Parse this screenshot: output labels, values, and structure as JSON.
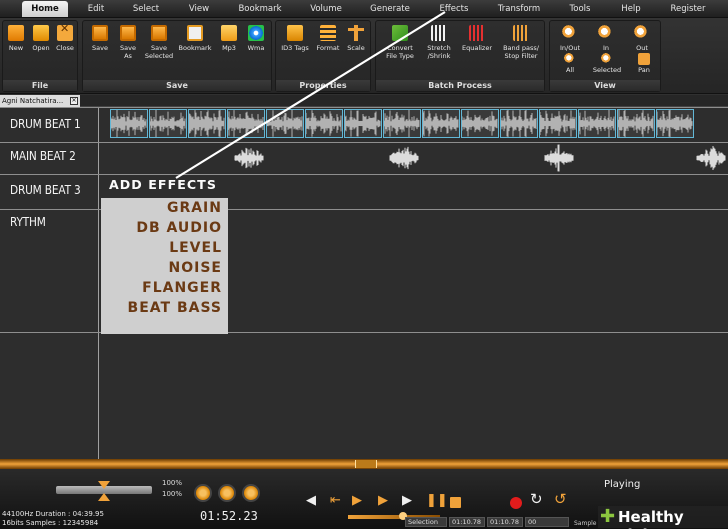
{
  "menu": {
    "items": [
      "Home",
      "Edit",
      "Select",
      "View",
      "Bookmark",
      "Volume",
      "Generate",
      "Effects",
      "Transform",
      "Tools",
      "Help",
      "Register"
    ],
    "active": "Home"
  },
  "ribbon": {
    "file": {
      "label": "File",
      "tools": [
        "New",
        "Open",
        "Close"
      ]
    },
    "save": {
      "label": "Save",
      "tools": [
        "Save",
        "Save\nAs",
        "Save\nSelected",
        "Bookmark",
        "Mp3",
        "Wma"
      ]
    },
    "properties": {
      "label": "Properties",
      "tools": [
        "ID3 Tags",
        "Format",
        "Scale"
      ]
    },
    "batch": {
      "label": "Batch Process",
      "tools": [
        "Convert\nFile Type",
        "Stretch\n/Shrink",
        "Equalizer",
        "Band pass/\nStop Filter"
      ]
    },
    "view": {
      "label": "View",
      "tools": [
        "In/Out",
        "In",
        "Out",
        "All",
        "Selected",
        "Pan"
      ]
    }
  },
  "document_tab": {
    "label": "Agni Natchatira..."
  },
  "tracks": {
    "labels": [
      "DRUM BEAT 1",
      "MAIN BEAT 2",
      "DRUM BEAT 3",
      "RYTHM"
    ]
  },
  "annotation": {
    "title": "ADD EFFECTS"
  },
  "effects_list": [
    "GRAIN",
    "DB AUDIO",
    "LEVEL",
    "NOISE",
    "FLANGER",
    "BEAT BASS"
  ],
  "transport": {
    "pitch_top": "100%",
    "pitch_bottom": "100%",
    "time": "01:52.23",
    "format_line1": "44100Hz  Duration : 04:39.95",
    "format_line2": "16bits  Samples : 12345984",
    "selection_label": "Selection",
    "sel_start": "01:10.78",
    "sel_end": "01:10.78",
    "sel_len": "00",
    "samples_label": "Sample",
    "status": "Playing",
    "volume_level": 0.6
  },
  "watermark": {
    "text": "Healthy Living"
  },
  "colors": {
    "accent": "#f0a23a",
    "clip_border": "#62b7d6",
    "effect_text": "#6b3a14",
    "effects_panel_bg": "#cfcfcf"
  }
}
